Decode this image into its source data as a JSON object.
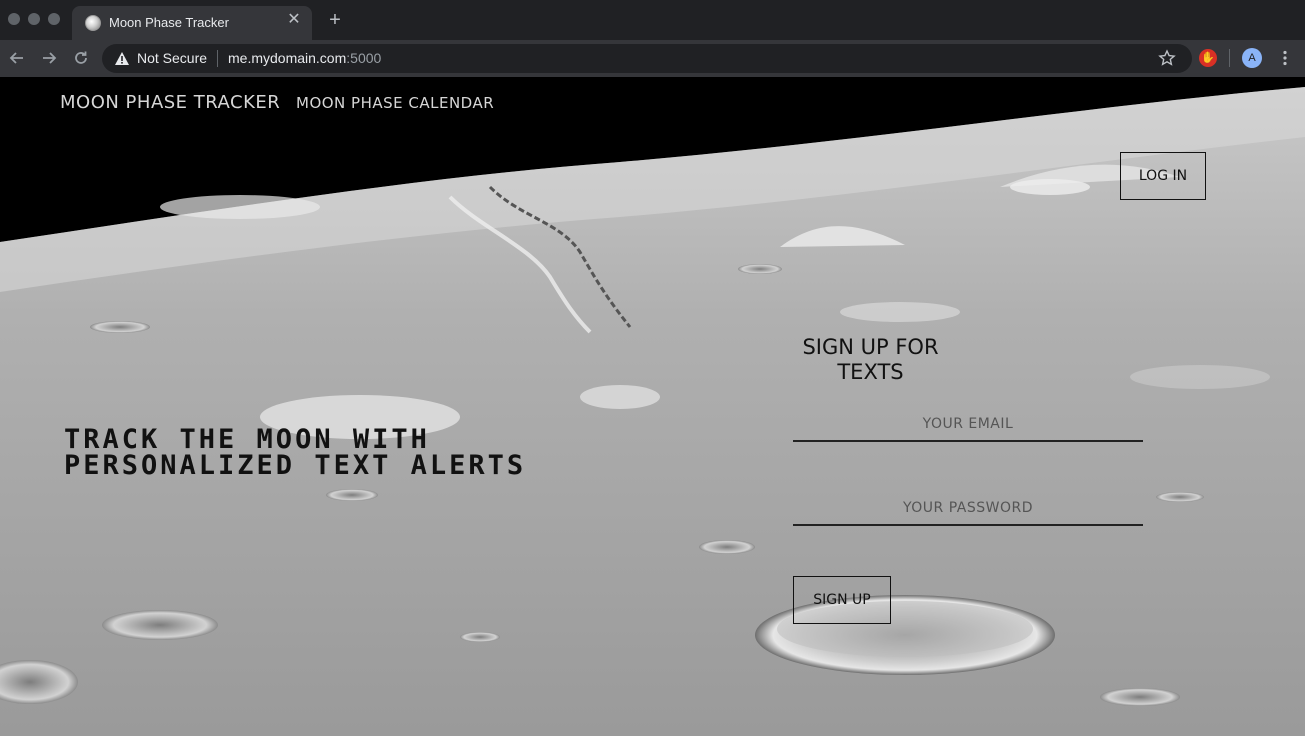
{
  "browser": {
    "tab_title": "Moon Phase Tracker",
    "close_glyph": "✕",
    "new_tab_glyph": "+",
    "security_label": "Not Secure",
    "url_host": "me.mydomain.com",
    "url_port": ":5000",
    "profile_initial": "A",
    "icons": [
      "back-icon",
      "forward-icon",
      "reload-icon",
      "warning-icon",
      "star-icon",
      "extension-icon",
      "menu-icon"
    ]
  },
  "nav": {
    "brand": "MOON PHASE TRACKER",
    "calendar_link": "MOON PHASE CALENDAR"
  },
  "auth": {
    "login_label": "LOG IN"
  },
  "hero": {
    "headline": "TRACK THE MOON WITH PERSONALIZED TEXT ALERTS"
  },
  "signup": {
    "title": "SIGN UP FOR TEXTS",
    "email_placeholder": "YOUR EMAIL",
    "password_placeholder": "YOUR PASSWORD",
    "submit_label": "SIGN UP"
  },
  "colors": {
    "chrome_dark": "#202124",
    "chrome_mid": "#35363a",
    "page_text": "#111111",
    "nav_text": "#d6d6d6"
  }
}
